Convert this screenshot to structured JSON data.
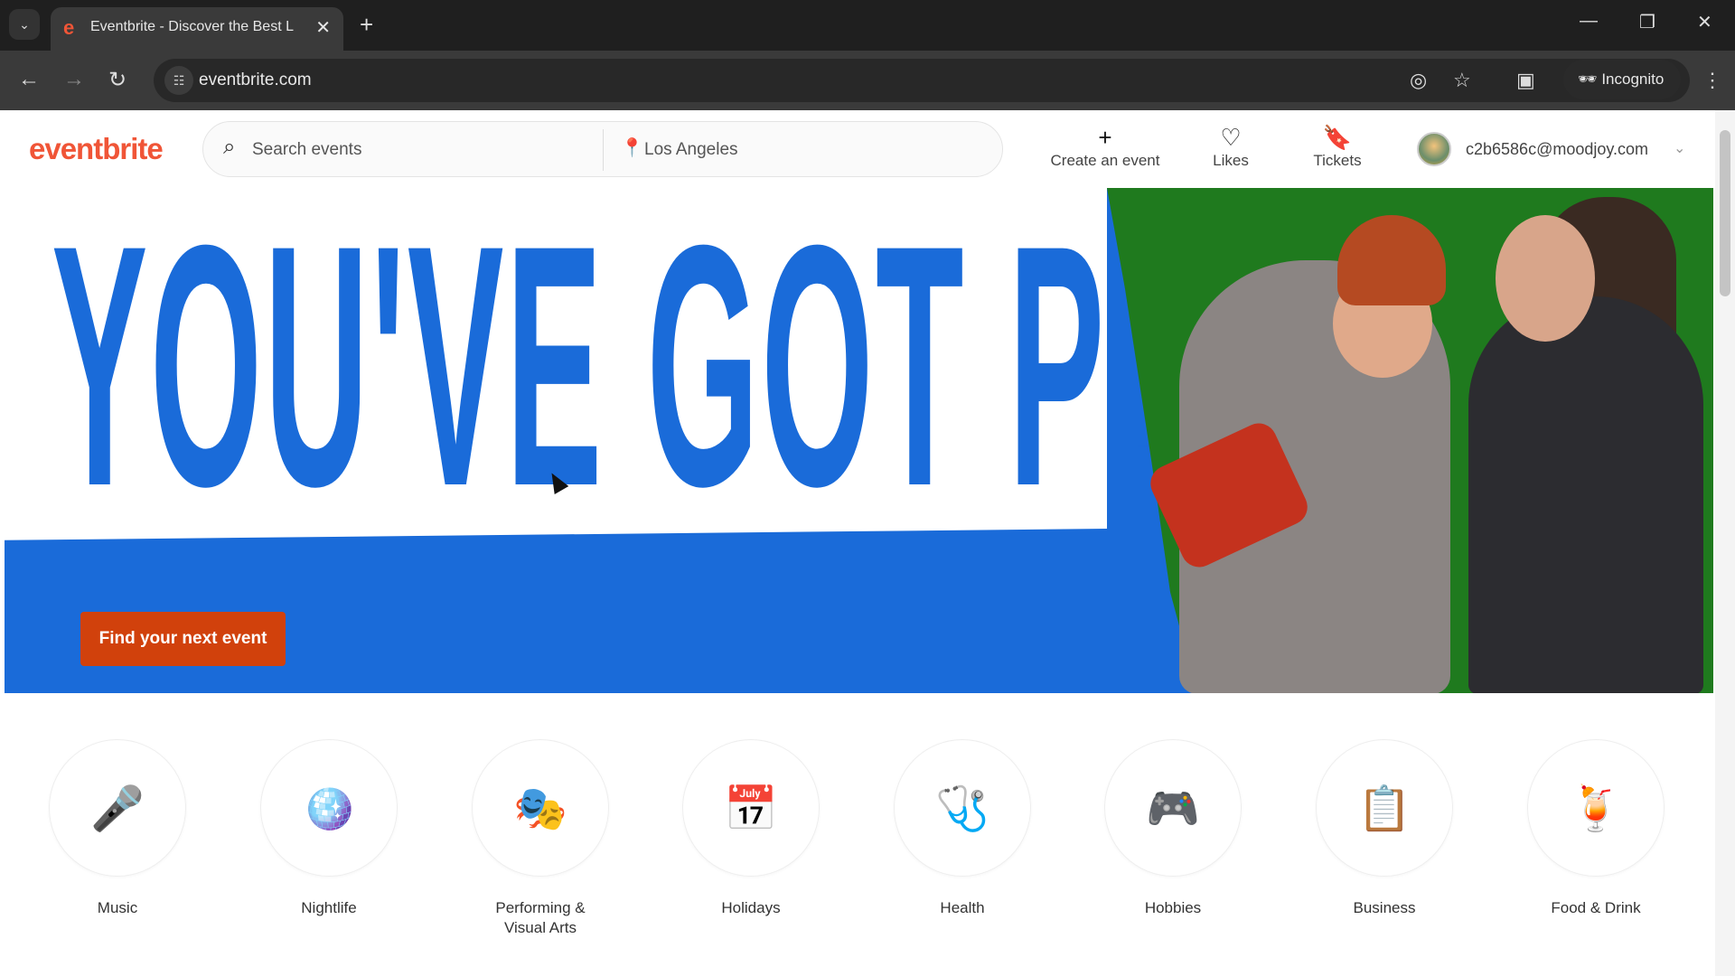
{
  "browser": {
    "tab_title": "Eventbrite - Discover the Best L",
    "url": "eventbrite.com",
    "incognito_label": "Incognito"
  },
  "header": {
    "logo": "eventbrite",
    "search_placeholder": "Search events",
    "location": "Los Angeles",
    "nav": [
      {
        "label": "Create an event",
        "icon": "plus-icon"
      },
      {
        "label": "Likes",
        "icon": "heart-icon"
      },
      {
        "label": "Tickets",
        "icon": "ticket-icon"
      }
    ],
    "user_email": "c2b6586c@moodjoy.com"
  },
  "hero": {
    "headline": "YOU'VE GOT PLANS",
    "cta": "Find your next event",
    "colors": {
      "blue": "#1a6bd9",
      "green": "#1f7a1e",
      "cta": "#d1410c"
    }
  },
  "categories": [
    {
      "label": "Music",
      "icon": "microphone-icon",
      "glyph": "🎤"
    },
    {
      "label": "Nightlife",
      "icon": "disco-ball-icon",
      "glyph": "🪩"
    },
    {
      "label": "Performing & Visual Arts",
      "icon": "theater-masks-icon",
      "glyph": "🎭"
    },
    {
      "label": "Holidays",
      "icon": "calendar-icon",
      "glyph": "📅"
    },
    {
      "label": "Health",
      "icon": "stethoscope-icon",
      "glyph": "🩺"
    },
    {
      "label": "Hobbies",
      "icon": "gamepad-icon",
      "glyph": "🎮"
    },
    {
      "label": "Business",
      "icon": "presentation-board-icon",
      "glyph": "📋"
    },
    {
      "label": "Food & Drink",
      "icon": "food-drink-icon",
      "glyph": "🍹"
    }
  ]
}
